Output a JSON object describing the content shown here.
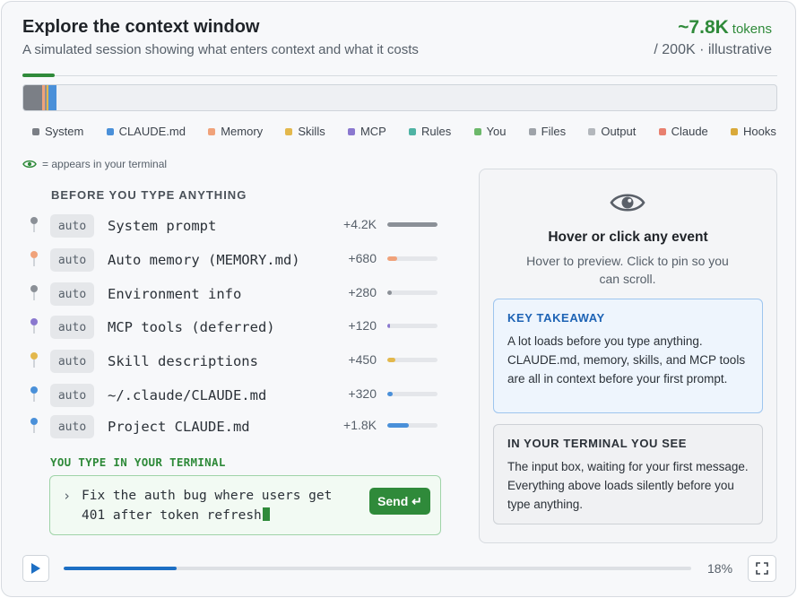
{
  "header": {
    "title": "Explore the context window",
    "subtitle": "A simulated session showing what enters context and what it costs",
    "token_count": "~7.8K",
    "token_unit": "tokens",
    "token_limit": "/  200K · illustrative"
  },
  "colors": {
    "accent_green": "#2f8a3a",
    "accent_blue": "#1d6fc4"
  },
  "context_bar": {
    "segments": [
      {
        "category": "System",
        "color": "#7b7f86",
        "fraction": 0.025
      },
      {
        "category": "Memory",
        "color": "#f0a27a",
        "fraction": 0.004
      },
      {
        "category": "System",
        "color": "#8b9097",
        "fraction": 0.0015
      },
      {
        "category": "MCP",
        "color": "#8a78cf",
        "fraction": 0.0008
      },
      {
        "category": "Skills",
        "color": "#e3b84c",
        "fraction": 0.0022
      },
      {
        "category": "CLAUDE.md",
        "color": "#4a90d9",
        "fraction": 0.011
      }
    ]
  },
  "legend": [
    {
      "label": "System",
      "color": "#7b7f86"
    },
    {
      "label": "CLAUDE.md",
      "color": "#4a90d9"
    },
    {
      "label": "Memory",
      "color": "#f0a27a"
    },
    {
      "label": "Skills",
      "color": "#e3b84c"
    },
    {
      "label": "MCP",
      "color": "#8a78cf"
    },
    {
      "label": "Rules",
      "color": "#4fb3a4"
    },
    {
      "label": "You",
      "color": "#6cb86a"
    },
    {
      "label": "Files",
      "color": "#9ea3a9"
    },
    {
      "label": "Output",
      "color": "#b3b7bc"
    },
    {
      "label": "Claude",
      "color": "#e8806f"
    },
    {
      "label": "Hooks",
      "color": "#d9a93a"
    }
  ],
  "note": "= appears in your terminal",
  "section_before": "BEFORE YOU TYPE ANYTHING",
  "events": [
    {
      "badge": "auto",
      "name": "System prompt",
      "cost": "+4.2K",
      "color": "#8b9097",
      "level": 1.0
    },
    {
      "badge": "auto",
      "name": "Auto memory (MEMORY.md)",
      "cost": "+680",
      "color": "#f0a27a",
      "level": 0.2
    },
    {
      "badge": "auto",
      "name": "Environment info",
      "cost": "+280",
      "color": "#8b9097",
      "level": 0.09
    },
    {
      "badge": "auto",
      "name": "MCP tools (deferred)",
      "cost": "+120",
      "color": "#8a78cf",
      "level": 0.05
    },
    {
      "badge": "auto",
      "name": "Skill descriptions",
      "cost": "+450",
      "color": "#e3b84c",
      "level": 0.16
    },
    {
      "badge": "auto",
      "name": "~/.claude/CLAUDE.md",
      "cost": "+320",
      "color": "#4a90d9",
      "level": 0.11
    },
    {
      "badge": "auto",
      "name": "Project CLAUDE.md",
      "cost": "+1.8K",
      "color": "#4a90d9",
      "level": 0.43
    }
  ],
  "section_you": "YOU TYPE IN YOUR TERMINAL",
  "prompt": {
    "caret": "›",
    "text": "Fix the auth bug where users get 401 after token refresh",
    "send_label": "Send ↵"
  },
  "panel": {
    "title": "Hover or click any event",
    "subtitle": "Hover to preview. Click to pin so you can scroll.",
    "takeaway_heading": "KEY TAKEAWAY",
    "takeaway_body": "A lot loads before you type anything. CLAUDE.md, memory, skills, and MCP tools are all in context before your first prompt.",
    "terminal_heading": "IN YOUR TERMINAL YOU SEE",
    "terminal_body": "The input box, waiting for your first message. Everything above loads silently before you type anything."
  },
  "playback": {
    "progress": 0.18,
    "progress_label": "18%"
  }
}
